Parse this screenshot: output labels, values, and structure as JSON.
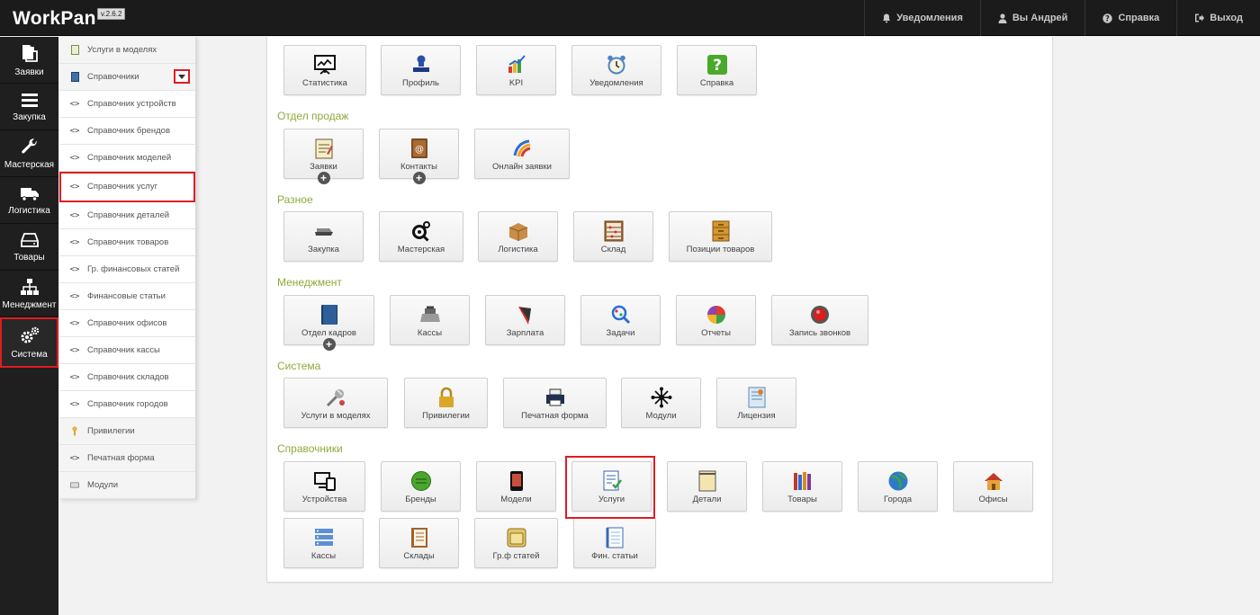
{
  "app": {
    "name": "WorkPan",
    "version": "v.2.6.2"
  },
  "topnav": [
    {
      "icon": "bell-icon",
      "label": "Уведомления"
    },
    {
      "icon": "user-icon",
      "label": "Вы Андрей"
    },
    {
      "icon": "question-icon",
      "label": "Справка"
    },
    {
      "icon": "logout-icon",
      "label": "Выход"
    }
  ],
  "leftnav": [
    {
      "icon": "documents-icon",
      "label": "Заявки"
    },
    {
      "icon": "bars-icon",
      "label": "Закупка"
    },
    {
      "icon": "wrench-icon",
      "label": "Мастерская"
    },
    {
      "icon": "truck-icon",
      "label": "Логистика"
    },
    {
      "icon": "hdd-icon",
      "label": "Товары"
    },
    {
      "icon": "sitemap-icon",
      "label": "Менеджмент"
    },
    {
      "icon": "gears-icon",
      "label": "Система",
      "active": true
    }
  ],
  "submenu": [
    {
      "icon": "book-icon",
      "label": "Услуги в моделях"
    },
    {
      "icon": "book-blue-icon",
      "label": "Справочники"
    },
    {
      "icon": "code-icon",
      "label": "Справочник устройств"
    },
    {
      "icon": "code-icon",
      "label": "Справочник брендов"
    },
    {
      "icon": "code-icon",
      "label": "Справочник моделей"
    },
    {
      "icon": "code-icon",
      "label": "Справочник услуг"
    },
    {
      "icon": "code-icon",
      "label": "Справочник деталей"
    },
    {
      "icon": "code-icon",
      "label": "Справочник товаров"
    },
    {
      "icon": "code-icon",
      "label": "Гр. финансовых статей"
    },
    {
      "icon": "code-icon",
      "label": "Финансовые статьи"
    },
    {
      "icon": "code-icon",
      "label": "Справочник офисов"
    },
    {
      "icon": "code-icon",
      "label": "Справочник кассы"
    },
    {
      "icon": "code-icon",
      "label": "Справочник складов"
    },
    {
      "icon": "code-icon",
      "label": "Справочник городов"
    },
    {
      "icon": "key-icon",
      "label": "Привилегии"
    },
    {
      "icon": "code-icon",
      "label": "Печатная форма"
    },
    {
      "icon": "keyboard-icon",
      "label": "Модули"
    }
  ],
  "sections": {
    "top": [
      {
        "icon": "chart-board-icon",
        "label": "Статистика"
      },
      {
        "icon": "stamp-icon",
        "label": "Профиль"
      },
      {
        "icon": "kpi-chart-icon",
        "label": "KPI"
      },
      {
        "icon": "alarm-clock-icon",
        "label": "Уведомления"
      },
      {
        "icon": "help-icon",
        "label": "Справка"
      }
    ],
    "sales": {
      "title": "Отдел продаж",
      "tiles": [
        {
          "icon": "notepad-icon",
          "label": "Заявки",
          "plus": "+"
        },
        {
          "icon": "address-book-icon",
          "label": "Контакты",
          "plus": "+"
        },
        {
          "icon": "online-icon",
          "label": "Онлайн заявки"
        }
      ]
    },
    "misc": {
      "title": "Разное",
      "tiles": [
        {
          "icon": "stapler-icon",
          "label": "Закупка"
        },
        {
          "icon": "workshop-icon",
          "label": "Мастерская"
        },
        {
          "icon": "box-icon",
          "label": "Логистика"
        },
        {
          "icon": "abacus-icon",
          "label": "Склад"
        },
        {
          "icon": "cabinet-icon",
          "label": "Позиции товаров"
        }
      ]
    },
    "management": {
      "title": "Менеджмент",
      "tiles": [
        {
          "icon": "hr-book-icon",
          "label": "Отдел кадров",
          "plus": "+"
        },
        {
          "icon": "cash-register-icon",
          "label": "Кассы"
        },
        {
          "icon": "salary-icon",
          "label": "Зарплата"
        },
        {
          "icon": "tasks-icon",
          "label": "Задачи"
        },
        {
          "icon": "pie-chart-icon",
          "label": "Отчеты"
        },
        {
          "icon": "record-icon",
          "label": "Запись звонков"
        }
      ]
    },
    "system": {
      "title": "Система",
      "tiles": [
        {
          "icon": "tools-icon",
          "label": "Услуги в моделях"
        },
        {
          "icon": "lock-icon",
          "label": "Привилегии"
        },
        {
          "icon": "printer-icon",
          "label": "Печатная форма"
        },
        {
          "icon": "modules-icon",
          "label": "Модули"
        },
        {
          "icon": "license-icon",
          "label": "Лицензия"
        }
      ]
    },
    "directories": {
      "title": "Справочники",
      "tiles": [
        {
          "icon": "devices-icon",
          "label": "Устройства"
        },
        {
          "icon": "brand-icon",
          "label": "Бренды"
        },
        {
          "icon": "phone-icon",
          "label": "Модели"
        },
        {
          "icon": "services-icon",
          "label": "Услуги"
        },
        {
          "icon": "details-icon",
          "label": "Детали"
        },
        {
          "icon": "books-icon",
          "label": "Товары"
        },
        {
          "icon": "globe-icon",
          "label": "Города"
        },
        {
          "icon": "office-icon",
          "label": "Офисы"
        },
        {
          "icon": "server-icon",
          "label": "Кассы"
        },
        {
          "icon": "warehouse-book-icon",
          "label": "Склады"
        },
        {
          "icon": "folder-icon",
          "label": "Гр.ф статей"
        },
        {
          "icon": "fin-notebook-icon",
          "label": "Фин. статьи"
        }
      ]
    }
  },
  "colors": {
    "highlight": "#e01b24",
    "section_title": "#8cab3c",
    "topbar": "#1b1b1b"
  }
}
